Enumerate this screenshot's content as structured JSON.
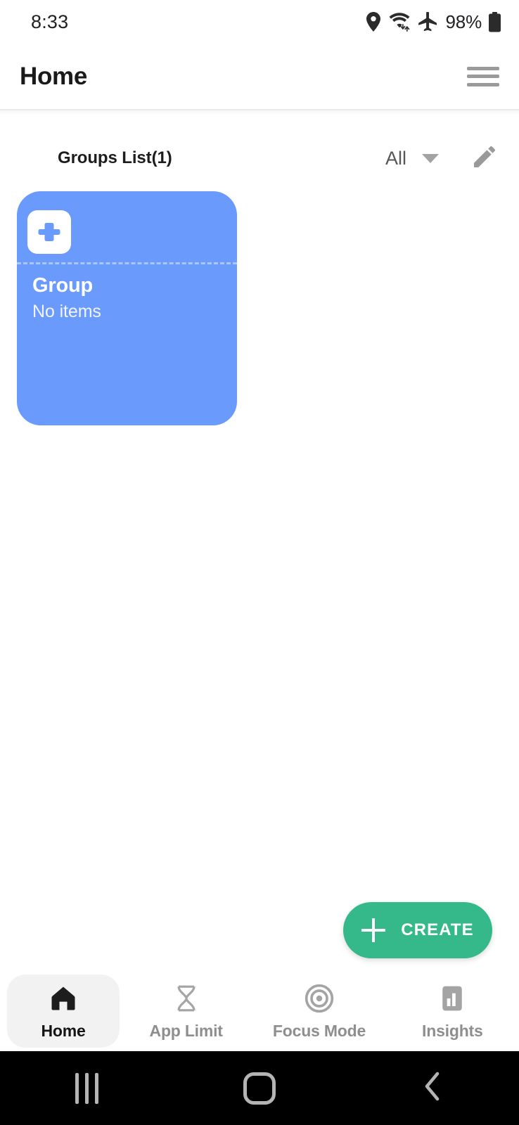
{
  "status_bar": {
    "time": "8:33",
    "battery_percent": "98%",
    "icons": [
      "location-icon",
      "wifi-icon",
      "airplane-mode-icon",
      "battery-icon"
    ]
  },
  "app_bar": {
    "title": "Home",
    "menu_icon": "hamburger-menu-icon"
  },
  "list_header": {
    "title": "Groups List(1)",
    "filter_value": "All",
    "filter_options": [
      "All"
    ],
    "edit_icon": "pencil-edit-icon"
  },
  "groups": [
    {
      "name": "Group",
      "subtitle": "No items",
      "icon": "plus-square-icon",
      "color": "#699afc"
    }
  ],
  "fab": {
    "label": "CREATE",
    "icon": "plus-icon",
    "color": "#35b98a"
  },
  "bottom_nav": {
    "active_index": 0,
    "items": [
      {
        "label": "Home",
        "icon": "home-icon"
      },
      {
        "label": "App Limit",
        "icon": "hourglass-icon"
      },
      {
        "label": "Focus Mode",
        "icon": "target-icon"
      },
      {
        "label": "Insights",
        "icon": "bar-chart-icon"
      }
    ]
  },
  "system_nav": {
    "items": [
      {
        "name": "recents-button",
        "icon": "recents-icon"
      },
      {
        "name": "home-button",
        "icon": "square-icon"
      },
      {
        "name": "back-button",
        "icon": "chevron-left-icon"
      }
    ]
  },
  "colors": {
    "card_blue": "#699afc",
    "fab_green": "#35b98a",
    "active_tab_bg": "#f2f2f2",
    "text_primary": "#1a1a1a",
    "text_muted": "#8e8e8e"
  }
}
